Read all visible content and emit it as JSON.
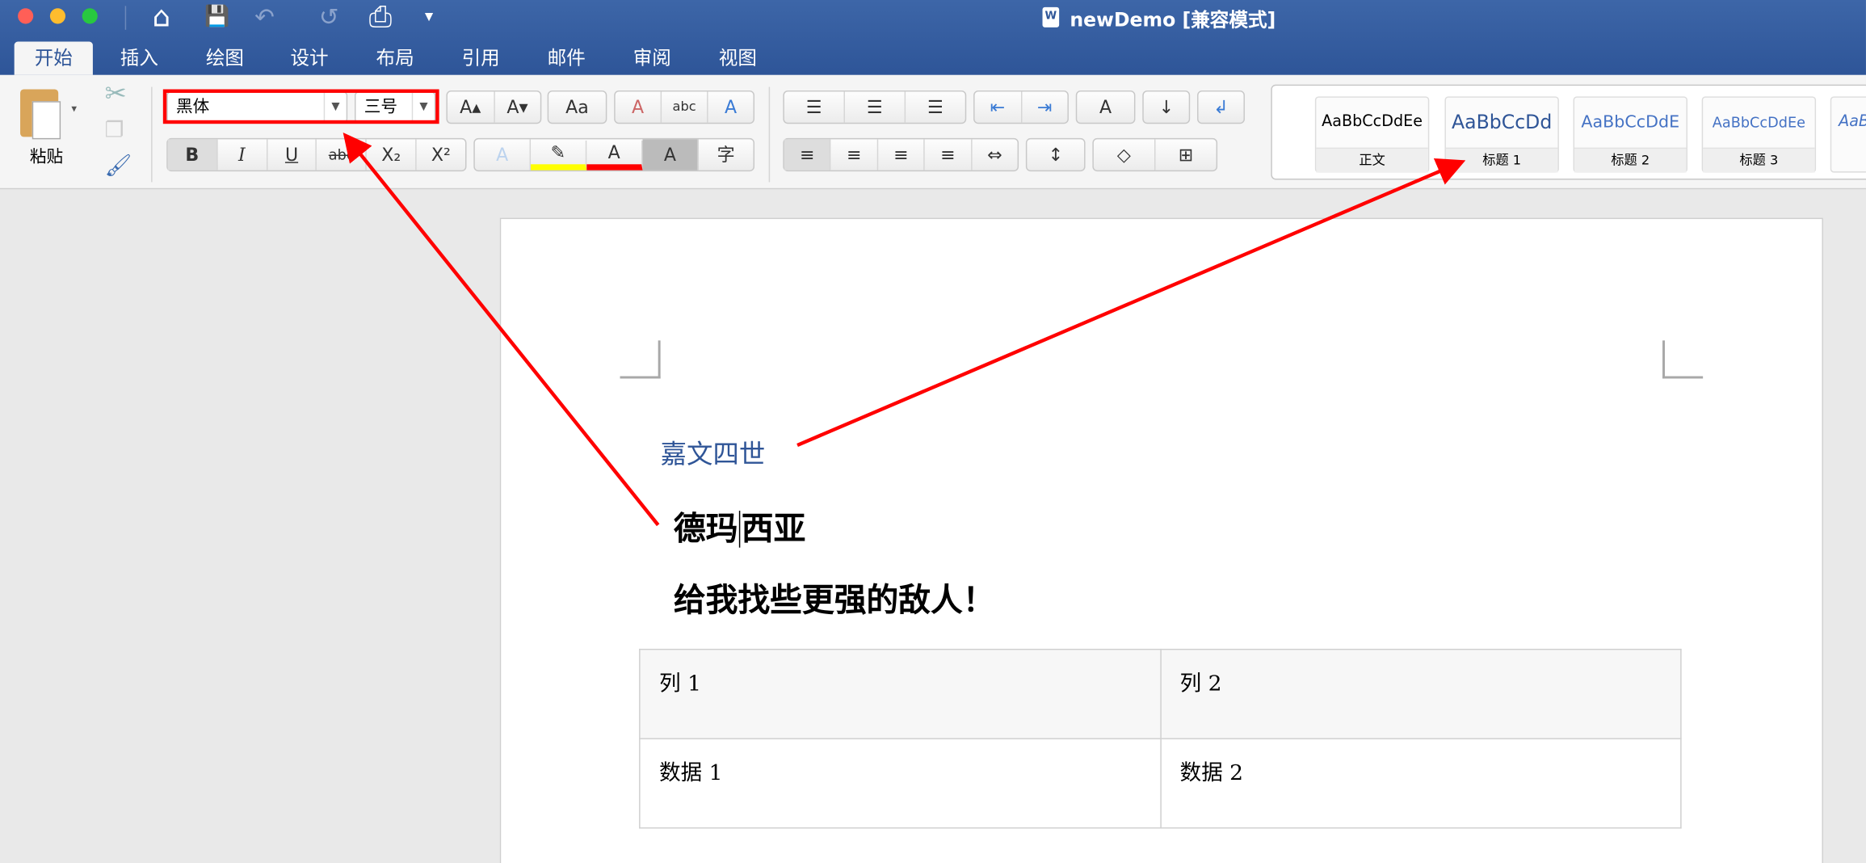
{
  "window": {
    "title": "newDemo [兼容模式]",
    "traffic_lights": {
      "close": "#ff5f57",
      "minimize": "#febc2e",
      "zoom": "#28c840"
    }
  },
  "quick_access": {
    "icons": [
      "home-icon",
      "save-icon",
      "undo-icon",
      "redo-icon",
      "print-icon",
      "customize-icon"
    ],
    "glyphs": {
      "home": "⌂",
      "save": "💾",
      "undo": "↶",
      "redo": "↺",
      "print": "⎙",
      "more": "▾"
    }
  },
  "tabs": [
    {
      "label": "开始",
      "active": true
    },
    {
      "label": "插入"
    },
    {
      "label": "绘图"
    },
    {
      "label": "设计"
    },
    {
      "label": "布局"
    },
    {
      "label": "引用"
    },
    {
      "label": "邮件"
    },
    {
      "label": "审阅"
    },
    {
      "label": "视图"
    }
  ],
  "ribbon": {
    "paste_label": "粘贴",
    "font_name": "黑体",
    "font_size": "三号",
    "format_buttons": {
      "bold": "B",
      "italic": "I",
      "underline": "U",
      "strike": "abc",
      "subscript": "X₂",
      "superscript": "X²",
      "phonetic": "字"
    },
    "grow": "A▴",
    "shrink": "A▾",
    "change_case": "Aa",
    "clear": "A",
    "abc": "abc",
    "border_a": "A",
    "font_color": "A",
    "shade": "A",
    "text_effect": "A",
    "highlight_color": "#ffff00",
    "font_color_value": "#ff0000"
  },
  "styles": [
    {
      "preview": "AaBbCcDdEe",
      "name": "正文",
      "color": "#000000"
    },
    {
      "preview": "AaBbCcDd",
      "name": "标题 1",
      "color": "#2f5597"
    },
    {
      "preview": "AaBbCcDdE",
      "name": "标题 2",
      "color": "#4472c4"
    },
    {
      "preview": "AaBbCcDdEe",
      "name": "标题 3",
      "color": "#4472c4"
    },
    {
      "preview": "AaB",
      "name": "",
      "color": "#4472c4"
    }
  ],
  "document": {
    "heading1": "嘉文四世",
    "line1_before_cursor": "德玛",
    "line1_after_cursor": "西亚",
    "line2": "给我找些更强的敌人！",
    "table": {
      "rows": [
        [
          "列 1",
          "列 2"
        ],
        [
          "数据 1",
          "数据 2"
        ]
      ]
    }
  },
  "annotation_color": "#ff0000"
}
